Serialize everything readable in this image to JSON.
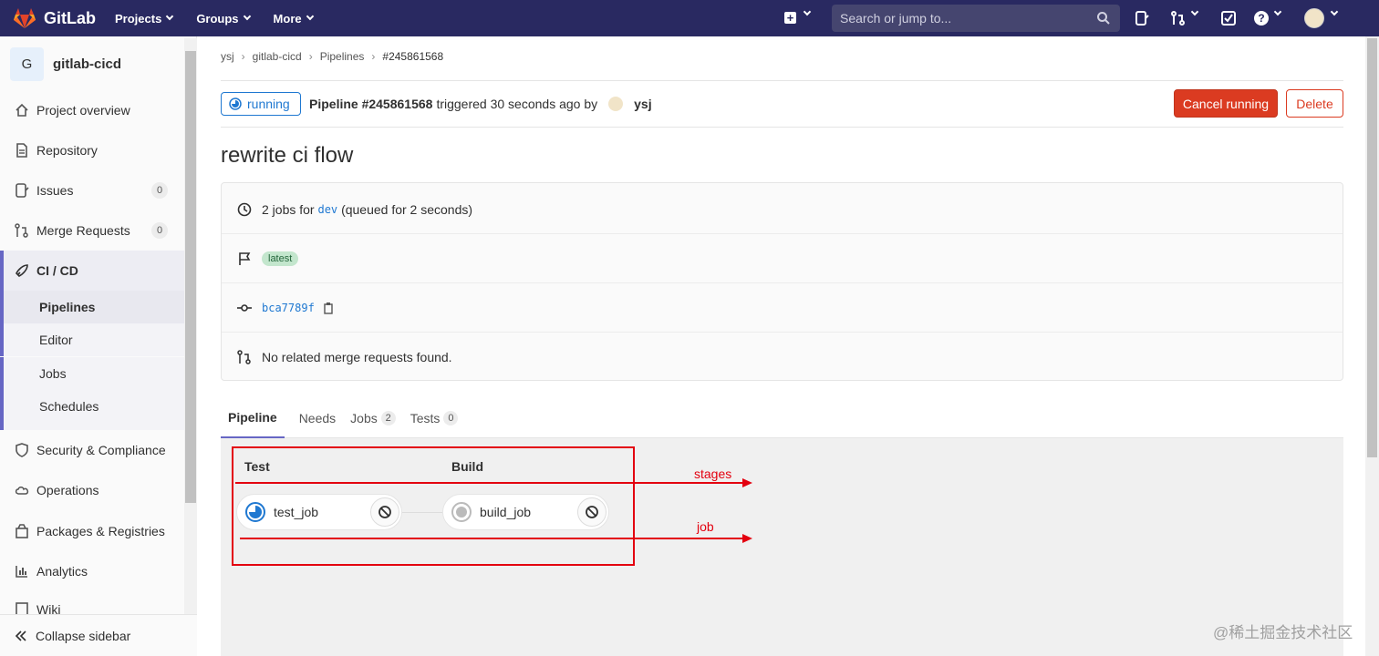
{
  "topbar": {
    "brand": "GitLab",
    "nav": [
      "Projects",
      "Groups",
      "More"
    ],
    "search_placeholder": "Search or jump to..."
  },
  "sidebar": {
    "project_initial": "G",
    "project_name": "gitlab-cicd",
    "items": [
      {
        "label": "Project overview",
        "icon": "home-icon"
      },
      {
        "label": "Repository",
        "icon": "doc-icon"
      },
      {
        "label": "Issues",
        "icon": "issues-icon",
        "badge": "0"
      },
      {
        "label": "Merge Requests",
        "icon": "merge-request-icon",
        "badge": "0"
      },
      {
        "label": "CI / CD",
        "icon": "rocket-icon"
      },
      {
        "label": "Security & Compliance",
        "icon": "shield-icon"
      },
      {
        "label": "Operations",
        "icon": "cloud-icon"
      },
      {
        "label": "Packages & Registries",
        "icon": "package-icon"
      },
      {
        "label": "Analytics",
        "icon": "chart-icon"
      },
      {
        "label": "Wiki",
        "icon": "book-icon"
      }
    ],
    "cicd_subitems": [
      "Pipelines",
      "Editor",
      "Jobs",
      "Schedules"
    ],
    "collapse_label": "Collapse sidebar"
  },
  "breadcrumb": [
    "ysj",
    "gitlab-cicd",
    "Pipelines",
    "#245861568"
  ],
  "header": {
    "status": "running",
    "pipeline_label": "Pipeline #245861568",
    "triggered_text": "triggered 30 seconds ago by",
    "user": "ysj",
    "cancel_label": "Cancel running",
    "delete_label": "Delete"
  },
  "title": "rewrite ci flow",
  "info": {
    "jobs_prefix": "2 jobs for",
    "branch": "dev",
    "queued": "(queued for 2 seconds)",
    "tag": "latest",
    "commit": "bca7789f",
    "merge_requests": "No related merge requests found."
  },
  "tabs": [
    {
      "label": "Pipeline",
      "count": null
    },
    {
      "label": "Needs",
      "count": null
    },
    {
      "label": "Jobs",
      "count": "2"
    },
    {
      "label": "Tests",
      "count": "0"
    }
  ],
  "graph": {
    "stages": [
      "Test",
      "Build"
    ],
    "jobs": [
      {
        "name": "test_job",
        "status": "running"
      },
      {
        "name": "build_job",
        "status": "created"
      }
    ],
    "annotations": {
      "stages": "stages",
      "job": "job"
    }
  },
  "colors": {
    "nav_bg": "#292961",
    "accent": "#1f78d1",
    "danger": "#db3b21",
    "annotation": "#e3000f"
  },
  "watermark": "@稀土掘金技术社区"
}
